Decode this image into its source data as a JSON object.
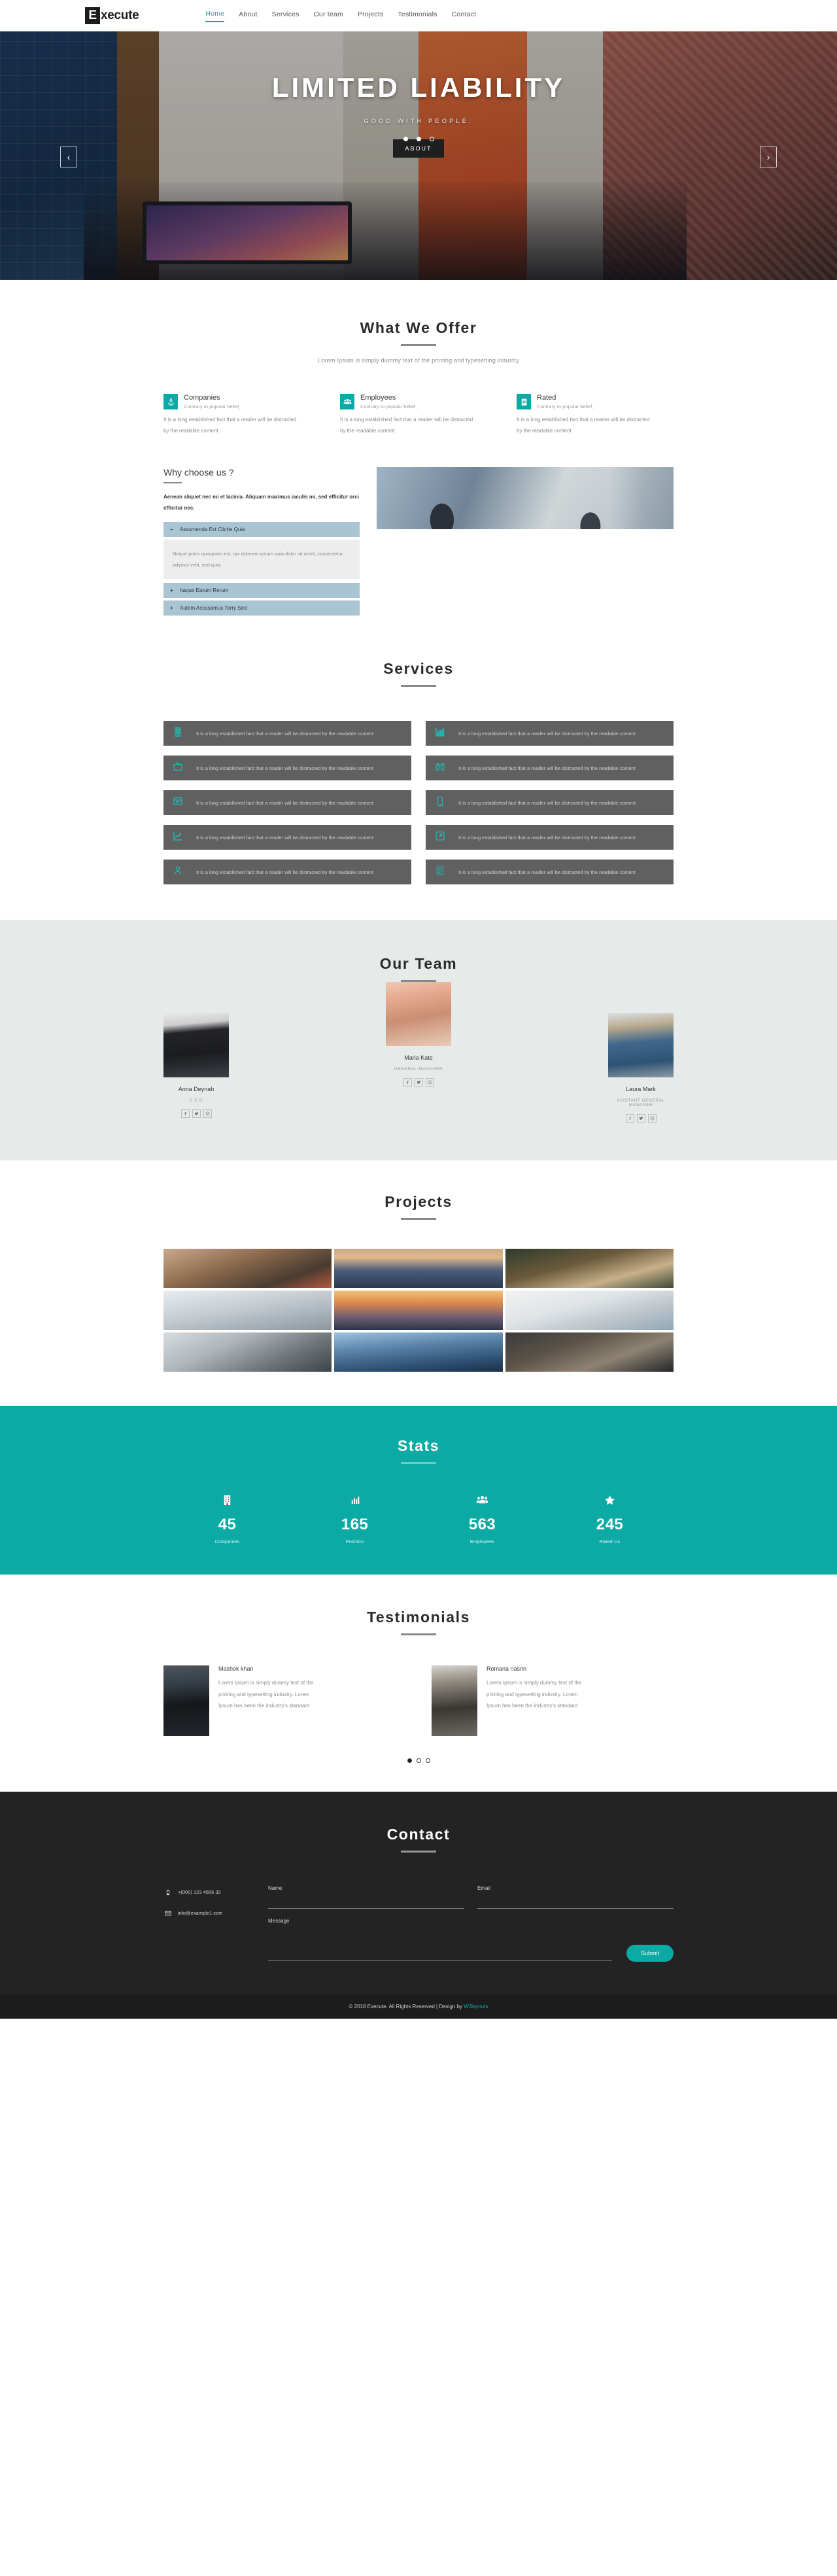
{
  "brand": {
    "badge": "E",
    "rest": "xecute"
  },
  "nav": {
    "items": [
      {
        "label": "Home",
        "active": true
      },
      {
        "label": "About",
        "active": false
      },
      {
        "label": "Services",
        "active": false
      },
      {
        "label": "Our team",
        "active": false
      },
      {
        "label": "Projects",
        "active": false
      },
      {
        "label": "Testimonials",
        "active": false
      },
      {
        "label": "Contact",
        "active": false
      }
    ]
  },
  "hero": {
    "title": "LIMITED LIABILITY",
    "subtitle": "GOOD WITH PEOPLE.",
    "button": "ABOUT",
    "prev": "‹",
    "next": "›"
  },
  "offer": {
    "title": "What We Offer",
    "lead": "Lorem Ipsum is simply dummy text of the printing and typesetting industry",
    "cards": [
      {
        "icon": "anchor-icon",
        "heading": "Companies",
        "sub": "Contrary to popular belief,",
        "body": "It is a long established fact that a reader will be distracted by the readable content"
      },
      {
        "icon": "users-icon",
        "heading": "Employees",
        "sub": "Contrary to popular belief,",
        "body": "It is a long established fact that a reader will be distracted by the readable content"
      },
      {
        "icon": "clipboard-icon",
        "heading": "Rated",
        "sub": "Contrary to popular belief,",
        "body": "It is a long established fact that a reader will be distracted by the readable content"
      }
    ]
  },
  "why": {
    "heading": "Why choose us ?",
    "lead": "Aenean aliquet nec mi et lacinia. Aliquam maximus iaculis mi, sed efficitur orci efficitur nec.",
    "accordion": [
      {
        "sign": "–",
        "label": "Assumenda Est Cliche Quia",
        "open": true,
        "body": "Neque porro quisquam est, qui dolorem ipsum quia dolor sit amet, consectetur, adipisci velit, sed quia."
      },
      {
        "sign": "+",
        "label": "Itaque Earum Rerum",
        "open": false,
        "body": ""
      },
      {
        "sign": "+",
        "label": "Autem Accusamus Terry Sed",
        "open": false,
        "body": ""
      }
    ]
  },
  "services": {
    "title": "Services",
    "cards": [
      {
        "icon": "building-icon",
        "text": "It is a long established fact that a reader will be distracted by the readable content"
      },
      {
        "icon": "bar-chart-icon",
        "text": "It is a long established fact that a reader will be distracted by the readable content"
      },
      {
        "icon": "briefcase-icon",
        "text": "It is a long established fact that a reader will be distracted by the readable content"
      },
      {
        "icon": "binoculars-icon",
        "text": "It is a long established fact that a reader will be distracted by the readable content"
      },
      {
        "icon": "form-icon",
        "text": "It is a long established fact that a reader will be distracted by the readable content"
      },
      {
        "icon": "mobile-icon",
        "text": "It is a long established fact that a reader will be distracted by the readable content"
      },
      {
        "icon": "line-chart-icon",
        "text": "It is a long established fact that a reader will be distracted by the readable content"
      },
      {
        "icon": "external-link-icon",
        "text": "It is a long established fact that a reader will be distracted by the readable content"
      },
      {
        "icon": "user-icon",
        "text": "It is a long established fact that a reader will be distracted by the readable content"
      },
      {
        "icon": "list-icon",
        "text": "It is a long established fact that a reader will be distracted by the readable content"
      }
    ]
  },
  "team": {
    "title": "Our Team",
    "members": [
      {
        "name": "Anna Deynah",
        "role": "C.E.O"
      },
      {
        "name": "Maria Kate",
        "role": "GENERAL MANAGER"
      },
      {
        "name": "Laura Mark",
        "role": "ASISTANT GENERAL MANAGER"
      }
    ],
    "socials": [
      "facebook-icon",
      "twitter-icon",
      "dribbble-icon"
    ]
  },
  "projects": {
    "title": "Projects",
    "items": [
      {
        "name": "project-meeting-table"
      },
      {
        "name": "project-city-skyline"
      },
      {
        "name": "project-cafe-couple"
      },
      {
        "name": "project-conference-room"
      },
      {
        "name": "project-sunset-skyline"
      },
      {
        "name": "project-charts-desk"
      },
      {
        "name": "project-airport-runway"
      },
      {
        "name": "project-glass-building"
      },
      {
        "name": "project-workstation"
      }
    ]
  },
  "stats": {
    "title": "Stats",
    "items": [
      {
        "icon": "building-icon",
        "value": "45",
        "label": "Companies"
      },
      {
        "icon": "bar-chart-icon",
        "value": "165",
        "label": "Position"
      },
      {
        "icon": "users-icon",
        "value": "563",
        "label": "Employees"
      },
      {
        "icon": "star-icon",
        "value": "245",
        "label": "Rated Us"
      }
    ]
  },
  "testimonials": {
    "title": "Testimonials",
    "items": [
      {
        "name": "Mashok khan",
        "text": "Lorem Ipsum is simply dummy text of the printing and typesetting industry. Lorem Ipsum has been the industry's standard"
      },
      {
        "name": "Romana nasrin",
        "text": "Lorem Ipsum is simply dummy text of the printing and typesetting industry. Lorem Ipsum has been the industry's standard"
      }
    ]
  },
  "contact": {
    "title": "Contact",
    "phone": "+(000) 123 4565 32",
    "email": "info@example1.com",
    "name_label": "Name",
    "email_label": "Email",
    "message_label": "Message",
    "submit": "Submit"
  },
  "footer": {
    "text": "© 2018 Execute. All Rights Reserved | Design by ",
    "link": "W3layouts"
  },
  "colors": {
    "accent": "#0caaa4",
    "dark": "#232323",
    "card": "#606060"
  }
}
